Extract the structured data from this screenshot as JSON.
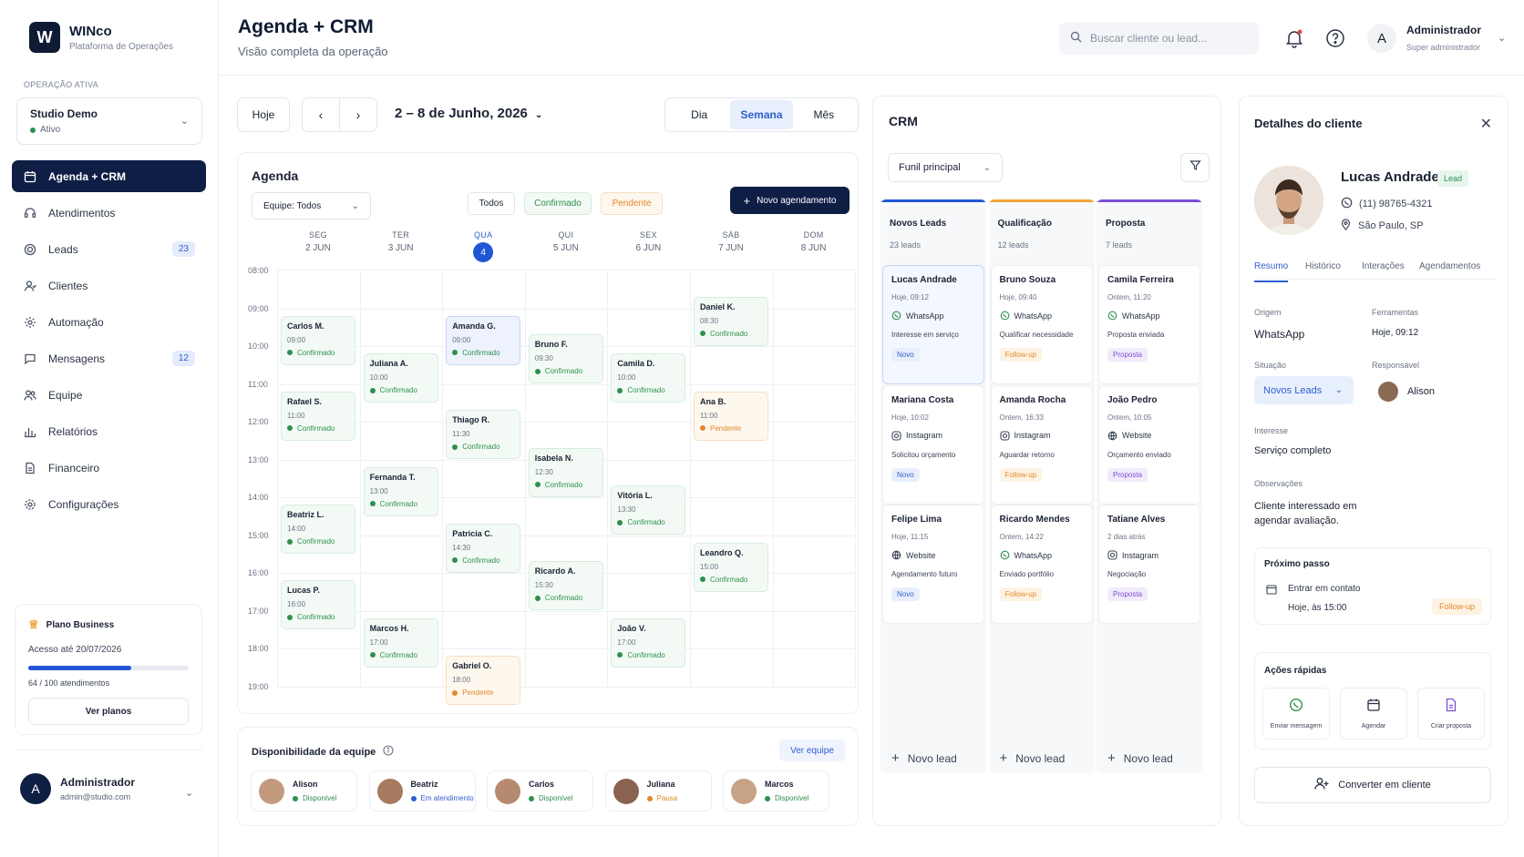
{
  "brand": {
    "logo_letter": "W",
    "name": "WINco",
    "subtitle": "Plataforma de Operações"
  },
  "operation": {
    "label": "OPERAÇÃO ATIVA",
    "name": "Studio Demo",
    "status": "Ativo"
  },
  "nav": [
    {
      "label": "Agenda + CRM",
      "icon": "calendar-icon",
      "active": true
    },
    {
      "label": "Atendimentos",
      "icon": "headset-icon"
    },
    {
      "label": "Leads",
      "icon": "target-icon",
      "badge": "23"
    },
    {
      "label": "Clientes",
      "icon": "users-icon"
    },
    {
      "label": "Automação",
      "icon": "automation-icon"
    },
    {
      "label": "Mensagens",
      "icon": "message-icon",
      "badge": "12"
    },
    {
      "label": "Equipe",
      "icon": "team-icon"
    },
    {
      "label": "Relatórios",
      "icon": "bar-chart-icon"
    },
    {
      "label": "Financeiro",
      "icon": "document-icon"
    },
    {
      "label": "Configurações",
      "icon": "gear-icon"
    }
  ],
  "plan": {
    "title": "Plano Business",
    "access": "Acesso até 20/07/2026",
    "usage": "64 / 100 atendimentos",
    "usage_fraction": 0.64,
    "button": "Ver planos"
  },
  "sidebar_user": {
    "initial": "A",
    "name": "Administrador",
    "email": "admin@studio.com"
  },
  "header": {
    "title": "Agenda + CRM",
    "subtitle": "Visão completa da operação",
    "search_placeholder": "Buscar cliente ou lead...",
    "user_initial": "A",
    "user_name": "Administrador",
    "user_role": "Super administrador"
  },
  "toolbar": {
    "today": "Hoje",
    "date_range": "2 – 8 de Junho, 2026",
    "views": [
      "Dia",
      "Semana",
      "Mês"
    ],
    "active_view": "Semana"
  },
  "agenda": {
    "title": "Agenda",
    "team_filter": "Equipe: Todos",
    "filters": [
      "Todos",
      "Confirmado",
      "Pendente"
    ],
    "new_button": "Novo agendamento",
    "days": [
      {
        "name": "SEG",
        "date": "2 JUN"
      },
      {
        "name": "TER",
        "date": "3 JUN"
      },
      {
        "name": "QUA",
        "date": "4",
        "today": true
      },
      {
        "name": "QUI",
        "date": "5 JUN"
      },
      {
        "name": "SEX",
        "date": "6 JUN"
      },
      {
        "name": "SÁB",
        "date": "7 JUN"
      },
      {
        "name": "DOM",
        "date": "8 JUN"
      }
    ],
    "times": [
      "08:00",
      "09:00",
      "10:00",
      "11:00",
      "12:00",
      "13:00",
      "14:00",
      "15:00",
      "16:00",
      "17:00",
      "18:00",
      "19:00"
    ],
    "events": [
      {
        "name": "Carlos M.",
        "time": "09:00",
        "status": "Confirmado",
        "day": 0,
        "start": 9.0
      },
      {
        "name": "Rafael S.",
        "time": "11:00",
        "status": "Confirmado",
        "day": 0,
        "start": 11.0
      },
      {
        "name": "Beatriz L.",
        "time": "14:00",
        "status": "Confirmado",
        "day": 0,
        "start": 14.0
      },
      {
        "name": "Lucas P.",
        "time": "16:00",
        "status": "Confirmado",
        "day": 0,
        "start": 16.0
      },
      {
        "name": "Juliana A.",
        "time": "10:00",
        "status": "Confirmado",
        "day": 1,
        "start": 10.0
      },
      {
        "name": "Fernanda T.",
        "time": "13:00",
        "status": "Confirmado",
        "day": 1,
        "start": 13.0
      },
      {
        "name": "Marcos H.",
        "time": "17:00",
        "status": "Confirmado",
        "day": 1,
        "start": 17.0
      },
      {
        "name": "Amanda G.",
        "time": "09:00",
        "status": "Confirmado",
        "day": 2,
        "start": 9.0,
        "selected": true
      },
      {
        "name": "Thiago R.",
        "time": "11:30",
        "status": "Confirmado",
        "day": 2,
        "start": 11.5
      },
      {
        "name": "Patricia C.",
        "time": "14:30",
        "status": "Confirmado",
        "day": 2,
        "start": 14.5
      },
      {
        "name": "Gabriel O.",
        "time": "18:00",
        "status": "Pendente",
        "day": 2,
        "start": 18.0
      },
      {
        "name": "Bruno F.",
        "time": "09:30",
        "status": "Confirmado",
        "day": 3,
        "start": 9.5
      },
      {
        "name": "Isabela N.",
        "time": "12:30",
        "status": "Confirmado",
        "day": 3,
        "start": 12.5
      },
      {
        "name": "Ricardo A.",
        "time": "15:30",
        "status": "Confirmado",
        "day": 3,
        "start": 15.5
      },
      {
        "name": "Camila D.",
        "time": "10:00",
        "status": "Confirmado",
        "day": 4,
        "start": 10.0
      },
      {
        "name": "Vitória L.",
        "time": "13:30",
        "status": "Confirmado",
        "day": 4,
        "start": 13.5
      },
      {
        "name": "João V.",
        "time": "17:00",
        "status": "Confirmado",
        "day": 4,
        "start": 17.0
      },
      {
        "name": "Daniel K.",
        "time": "08:30",
        "status": "Confirmado",
        "day": 5,
        "start": 8.5
      },
      {
        "name": "Ana B.",
        "time": "11:00",
        "status": "Pendente",
        "day": 5,
        "start": 11.0
      },
      {
        "name": "Leandro Q.",
        "time": "15:00",
        "status": "Confirmado",
        "day": 5,
        "start": 15.0
      }
    ]
  },
  "team": {
    "title": "Disponibilidade da equipe",
    "link": "Ver equipe",
    "members": [
      {
        "name": "Alison",
        "status": "Disponível",
        "color": "#2f8f4e"
      },
      {
        "name": "Beatriz",
        "status": "Em atendimento",
        "color": "#2f5fcf"
      },
      {
        "name": "Carlos",
        "status": "Disponível",
        "color": "#2f8f4e"
      },
      {
        "name": "Juliana",
        "status": "Pausa",
        "color": "#e4872b"
      },
      {
        "name": "Marcos",
        "status": "Disponível",
        "color": "#2f8f4e"
      }
    ]
  },
  "crm": {
    "title": "CRM",
    "funnel": "Funil principal",
    "add_label": "Novo lead",
    "columns": [
      {
        "title": "Novos Leads",
        "count": "23 leads",
        "color": "#2157d6",
        "cards": [
          {
            "name": "Lucas Andrade",
            "time": "Hoje, 09:12",
            "source": "WhatsApp",
            "note": "Interesse em serviço",
            "tag": "Novo",
            "selected": true
          },
          {
            "name": "Mariana Costa",
            "time": "Hoje, 10:02",
            "source": "Instagram",
            "note": "Solicitou orçamento",
            "tag": "Novo"
          },
          {
            "name": "Felipe Lima",
            "time": "Hoje, 11:15",
            "source": "Website",
            "note": "Agendamento futuro",
            "tag": "Novo"
          }
        ]
      },
      {
        "title": "Qualificação",
        "count": "12 leads",
        "color": "#f0a43a",
        "cards": [
          {
            "name": "Bruno Souza",
            "time": "Hoje, 09:40",
            "source": "WhatsApp",
            "note": "Qualificar necessidade",
            "tag": "Follow-up"
          },
          {
            "name": "Amanda Rocha",
            "time": "Ontem, 16:33",
            "source": "Instagram",
            "note": "Aguardar retorno",
            "tag": "Follow-up"
          },
          {
            "name": "Ricardo Mendes",
            "time": "Ontem, 14:22",
            "source": "WhatsApp",
            "note": "Enviado portfólio",
            "tag": "Follow-up"
          }
        ]
      },
      {
        "title": "Proposta",
        "count": "7 leads",
        "color": "#7b4fd4",
        "cards": [
          {
            "name": "Camila Ferreira",
            "time": "Ontem, 11:20",
            "source": "WhatsApp",
            "note": "Proposta enviada",
            "tag": "Proposta"
          },
          {
            "name": "João Pedro",
            "time": "Ontem, 10:05",
            "source": "Website",
            "note": "Orçamento enviado",
            "tag": "Proposta"
          },
          {
            "name": "Tatiane Alves",
            "time": "2 dias atrás",
            "source": "Instagram",
            "note": "Negociação",
            "tag": "Proposta"
          }
        ]
      }
    ]
  },
  "details": {
    "title": "Detalhes do cliente",
    "name": "Lucas Andrade",
    "badge": "Lead",
    "phone": "(11) 98765-4321",
    "location": "São Paulo, SP",
    "tabs": [
      "Resumo",
      "Histórico",
      "Interações",
      "Agendamentos"
    ],
    "origin_label": "Origem",
    "origin": "WhatsApp",
    "contact_label": "Ferramentas",
    "contact": "Hoje, 09:12",
    "situation_label": "Situação",
    "situation": "Novos Leads",
    "responsible_label": "Responsável",
    "responsible": "Alison",
    "interest_label": "Interesse",
    "interest": "Serviço completo",
    "notes_label": "Observações",
    "notes": "Cliente interessado em agendar avaliação.",
    "next_step_title": "Próximo passo",
    "next_step_action": "Entrar em contato",
    "next_step_when": "Hoje, às 15:00",
    "next_step_tag": "Follow-up",
    "quick_title": "Ações rápidas",
    "quick_actions": [
      "Enviar mensagem",
      "Agendar",
      "Criar proposta"
    ],
    "convert": "Converter em cliente"
  }
}
